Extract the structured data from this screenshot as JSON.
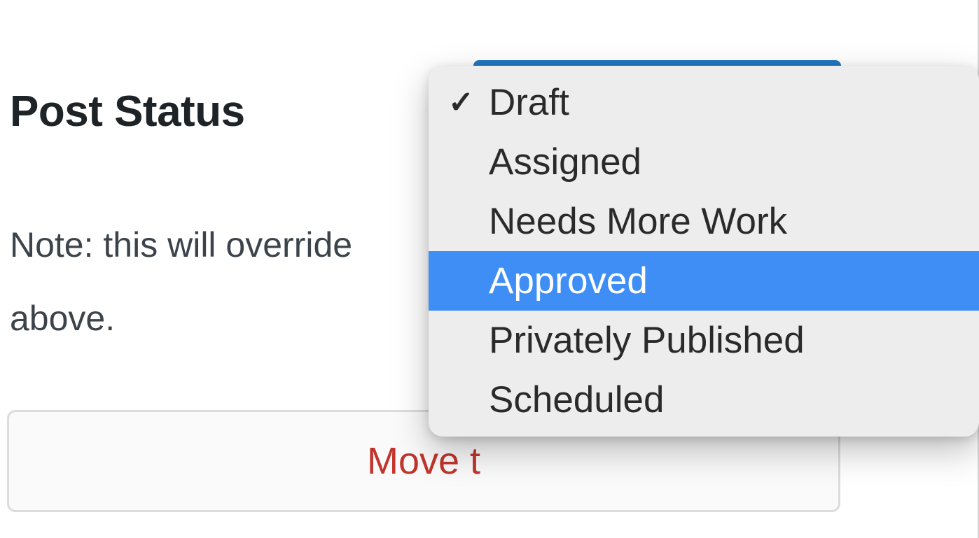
{
  "section": {
    "title": "Post Status",
    "note_line1": "Note: this will override",
    "note_line2": "above.",
    "trash_button": "Move t"
  },
  "dropdown": {
    "options": [
      {
        "label": "Draft",
        "checked": true,
        "highlighted": false
      },
      {
        "label": "Assigned",
        "checked": false,
        "highlighted": false
      },
      {
        "label": "Needs More Work",
        "checked": false,
        "highlighted": false
      },
      {
        "label": "Approved",
        "checked": false,
        "highlighted": true
      },
      {
        "label": "Privately Published",
        "checked": false,
        "highlighted": false
      },
      {
        "label": "Scheduled",
        "checked": false,
        "highlighted": false
      }
    ]
  }
}
